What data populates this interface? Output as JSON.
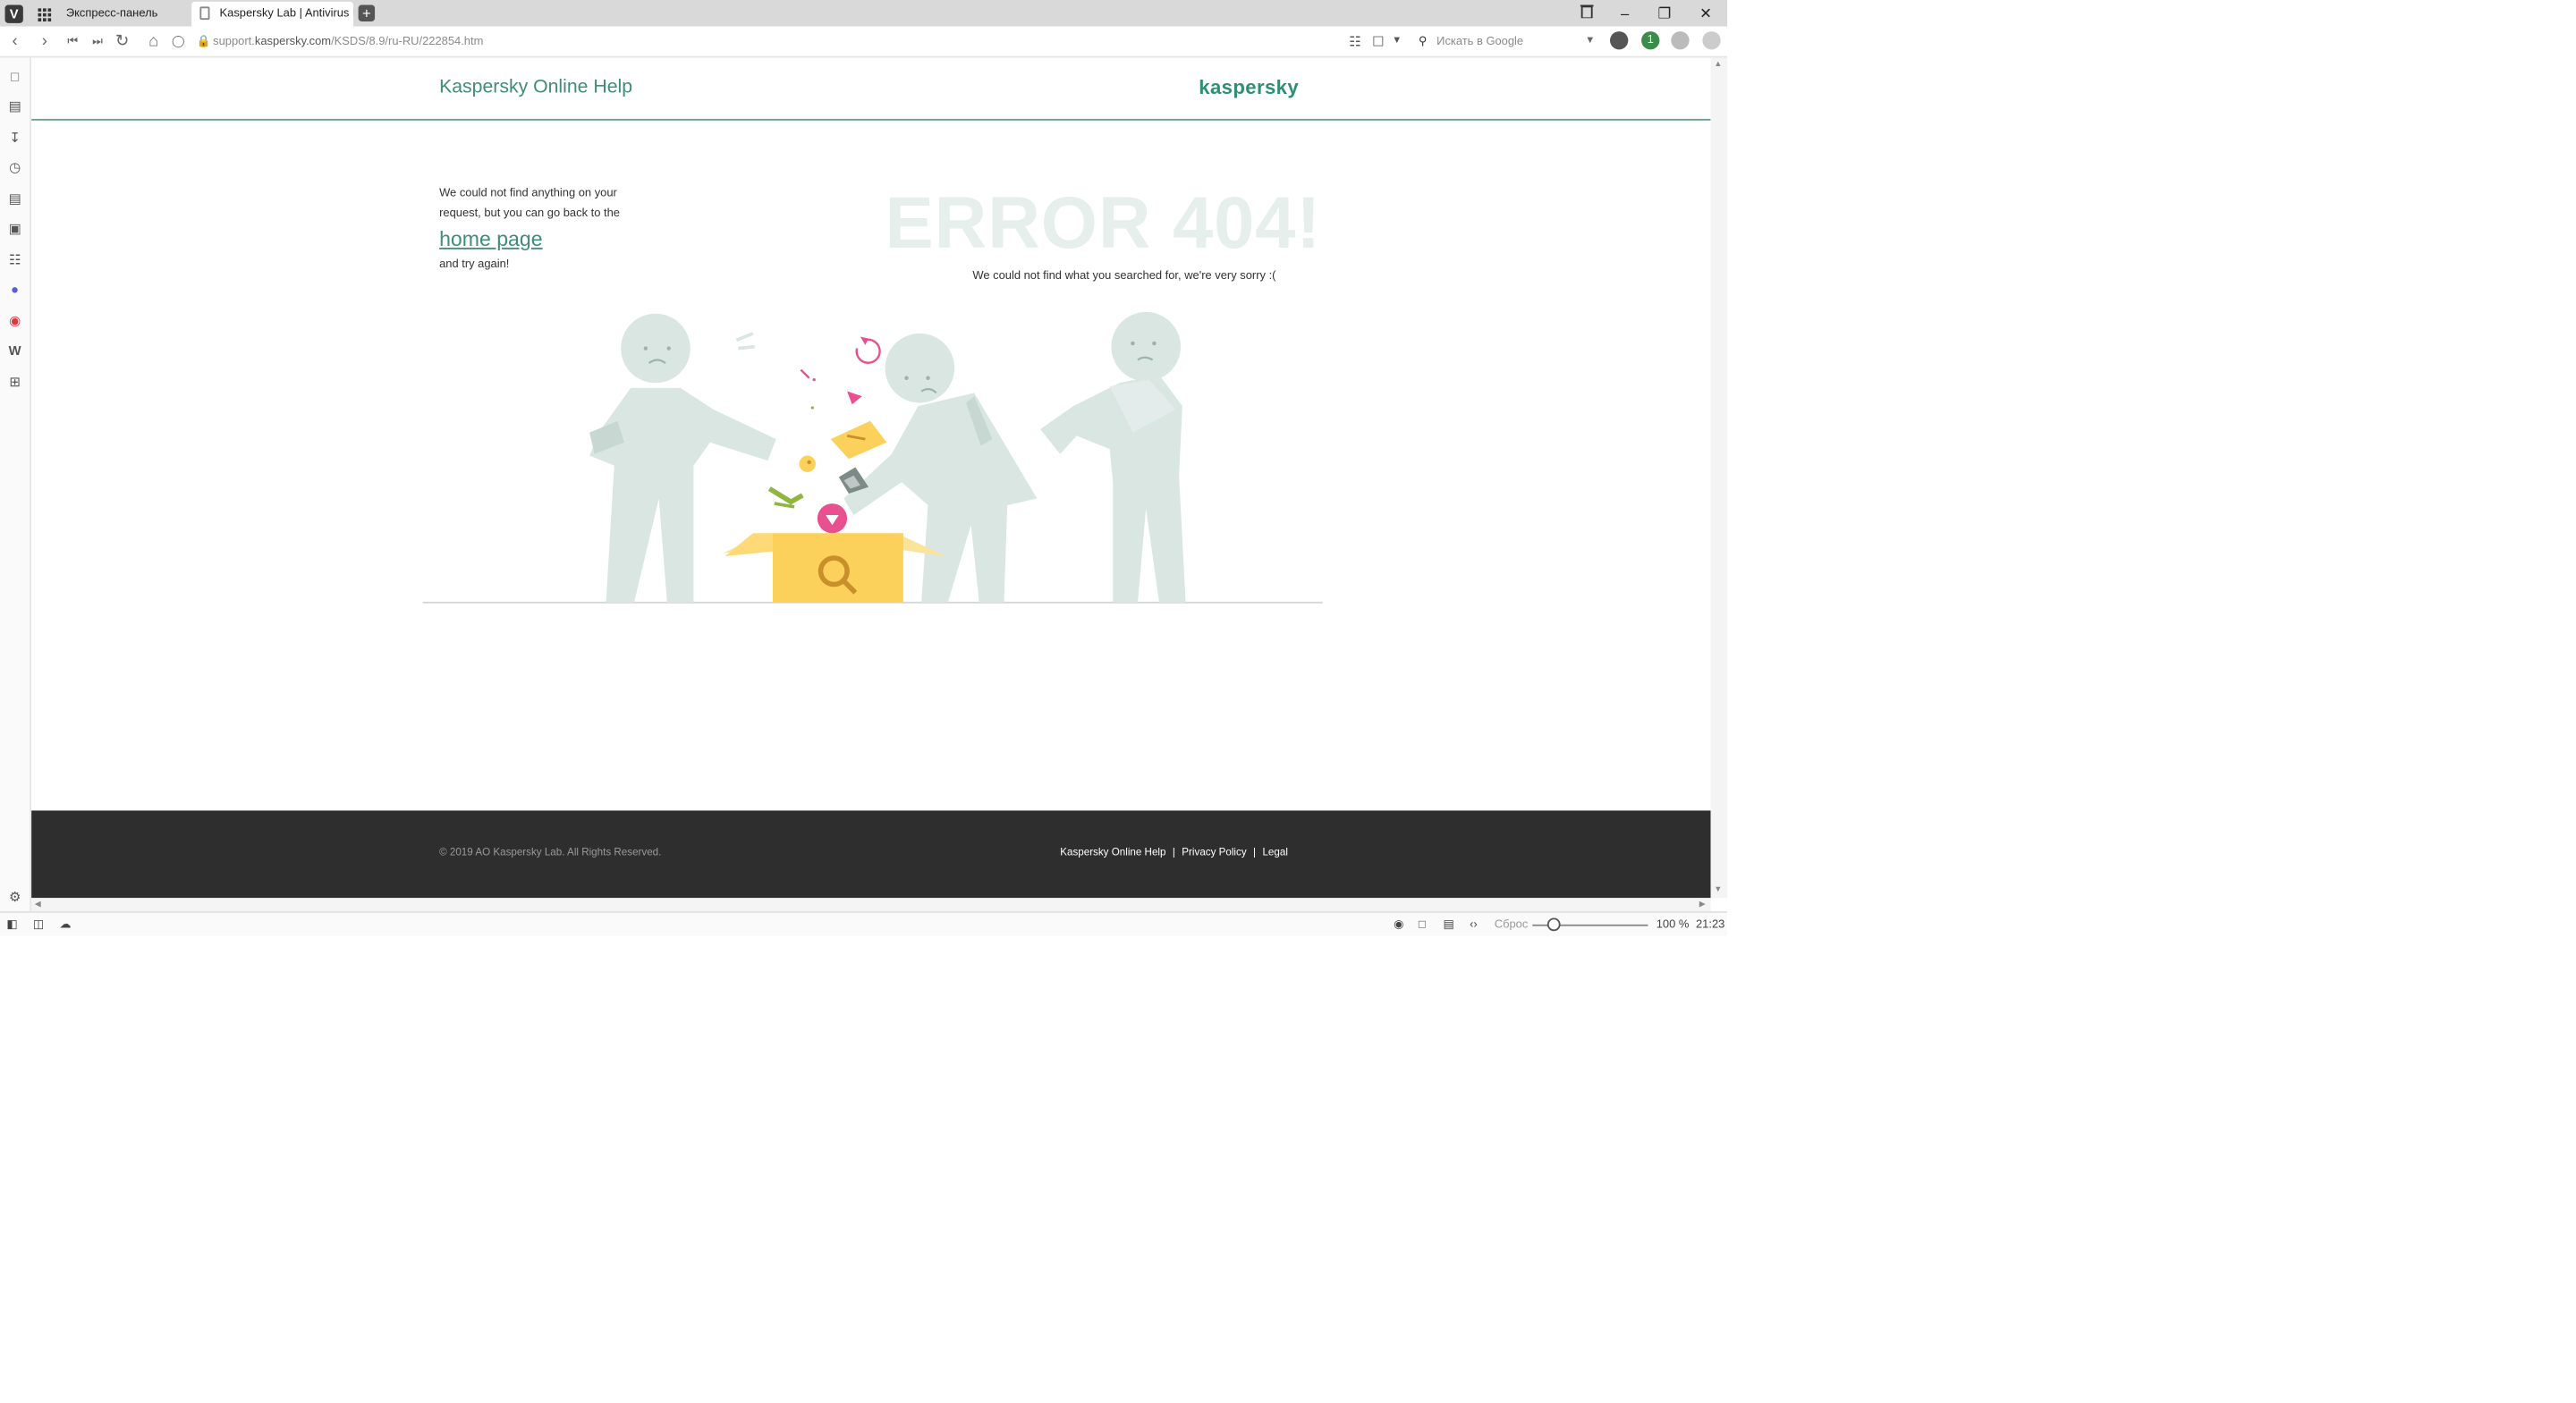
{
  "browser": {
    "tabs": [
      {
        "label": "Экспресс-панель"
      },
      {
        "label": "Kaspersky Lab | Antivirus P"
      }
    ],
    "url": {
      "prefix": "support.",
      "host": "kaspersky.com",
      "path": "/KSDS/8.9/ru-RU/222854.htm"
    },
    "search_placeholder": "Искать в Google",
    "extension_badge": "1",
    "status": {
      "reset_label": "Сброс",
      "zoom_label": "100 %",
      "clock": "21:23"
    }
  },
  "site": {
    "title": "Kaspersky Online Help",
    "logo": "kaspersky"
  },
  "error": {
    "left_line1": "We could not find anything on your",
    "left_line2": "request, but you can go back to the",
    "home_link": "home page",
    "left_line3": "and try again!",
    "heading": "ERROR 404!",
    "subtext": "We could not find what you searched for, we're very sorry :("
  },
  "footer": {
    "copyright": "© 2019 AO Kaspersky Lab. All Rights Reserved.",
    "links": [
      "Kaspersky Online Help",
      "Privacy Policy",
      "Legal"
    ],
    "separator": "|"
  },
  "colors": {
    "brand_green": "#3e8e77",
    "footer_bg": "#2e2e2e",
    "figure": "#d9e6e2",
    "box_yellow": "#fbd15b",
    "accent_pink": "#e8508f"
  }
}
